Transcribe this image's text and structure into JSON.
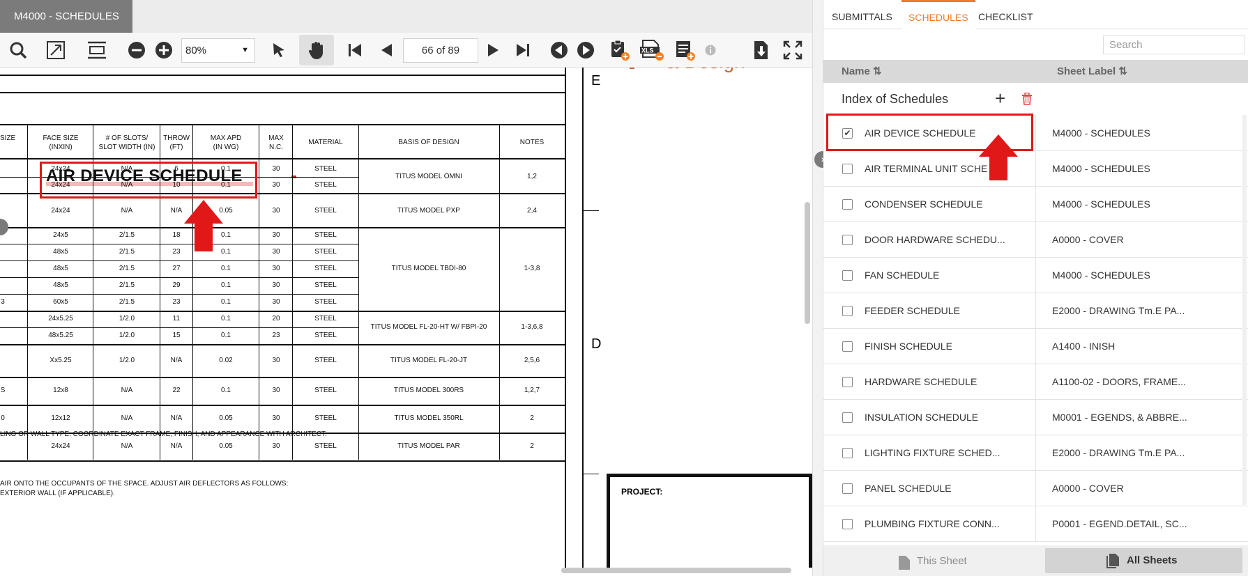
{
  "viewer": {
    "sheet_tab": "M4000 - SCHEDULES",
    "zoom": "80%",
    "page_indicator": "66 of 89"
  },
  "drawing": {
    "title": "AIR DEVICE SCHEDULE",
    "headers": [
      "SIZE",
      "FACE SIZE\n(INXIN)",
      "# OF SLOTS/\nSLOT WIDTH (IN)",
      "THROW\n(FT)",
      "MAX APD\n(IN WG)",
      "MAX\nN.C.",
      "MATERIAL",
      "BASIS OF DESIGN",
      "NOTES"
    ],
    "rows": [
      {
        "face": "24x24",
        "slots": "N/A",
        "throw": "6",
        "apd": "0.1",
        "nc": "30",
        "mat": "STEEL"
      },
      {
        "face": "24x24",
        "slots": "N/A",
        "throw": "10",
        "apd": "0.1",
        "nc": "30",
        "mat": "STEEL"
      },
      {
        "face": "24x24",
        "slots": "N/A",
        "throw": "N/A",
        "apd": "0.05",
        "nc": "30",
        "mat": "STEEL"
      },
      {
        "face": "24x5",
        "slots": "2/1.5",
        "throw": "18",
        "apd": "0.1",
        "nc": "30",
        "mat": "STEEL"
      },
      {
        "face": "48x5",
        "slots": "2/1.5",
        "throw": "23",
        "apd": "0.1",
        "nc": "30",
        "mat": "STEEL"
      },
      {
        "face": "48x5",
        "slots": "2/1.5",
        "throw": "27",
        "apd": "0.1",
        "nc": "30",
        "mat": "STEEL"
      },
      {
        "face": "48x5",
        "slots": "2/1.5",
        "throw": "29",
        "apd": "0.1",
        "nc": "30",
        "mat": "STEEL"
      },
      {
        "face": "60x5",
        "slots": "2/1.5",
        "throw": "23",
        "apd": "0.1",
        "nc": "30",
        "mat": "STEEL"
      },
      {
        "face": "24x5.25",
        "slots": "1/2.0",
        "throw": "11",
        "apd": "0.1",
        "nc": "20",
        "mat": "STEEL"
      },
      {
        "face": "48x5.25",
        "slots": "1/2.0",
        "throw": "15",
        "apd": "0.1",
        "nc": "23",
        "mat": "STEEL"
      },
      {
        "face": "Xx5.25",
        "slots": "1/2.0",
        "throw": "N/A",
        "apd": "0.02",
        "nc": "30",
        "mat": "STEEL"
      },
      {
        "face": "12x8",
        "slots": "N/A",
        "throw": "22",
        "apd": "0.1",
        "nc": "30",
        "mat": "STEEL"
      },
      {
        "face": "12x12",
        "slots": "N/A",
        "throw": "N/A",
        "apd": "0.05",
        "nc": "30",
        "mat": "STEEL"
      },
      {
        "face": "24x24",
        "slots": "N/A",
        "throw": "N/A",
        "apd": "0.05",
        "nc": "30",
        "mat": "STEEL"
      }
    ],
    "basis": [
      {
        "text": "TITUS MODEL OMNI",
        "notes": "1,2"
      },
      {
        "text": "TITUS MODEL PXP",
        "notes": "2,4"
      },
      {
        "text": "TITUS MODEL TBDI-80",
        "notes": "1-3,8"
      },
      {
        "text": "TITUS MODEL FL-20-HT W/ FBPI-20",
        "notes": "1-3,6,8"
      },
      {
        "text": "TITUS MODEL FL-20-JT",
        "notes": "2,5,6"
      },
      {
        "text": "TITUS MODEL 300RS",
        "notes": "1,2,7"
      },
      {
        "text": "TITUS MODEL 350RL",
        "notes": "2"
      },
      {
        "text": "TITUS MODEL PAR",
        "notes": "2"
      }
    ],
    "left_edge_marks": [
      "3",
      "S",
      "0"
    ],
    "note1": "LING OR WALL TYPE. COORDINATE EXACT FRAME, FINISH, AND APPEARANCE WITH ARCHITECT.",
    "note2": "AIR ONTO THE OCCUPANTS OF THE SPACE. ADJUST AIR DEFLECTORS AS FOLLOWS:",
    "note3": "EXTERIOR WALL (IF APPLICABLE).",
    "grid_e": "E",
    "grid_d": "D",
    "brand_partial": "& Design",
    "project_label": "PROJECT:"
  },
  "panel": {
    "tabs": [
      "SUBMITTALS",
      "SCHEDULES",
      "CHECKLIST"
    ],
    "search_placeholder": "Search",
    "col_name": "Name ⇅",
    "col_sheet": "Sheet Label ⇅",
    "group_title": "Index of Schedules",
    "items": [
      {
        "name": "AIR DEVICE SCHEDULE",
        "sheet": "M4000 - SCHEDULES",
        "checked": true
      },
      {
        "name": "AIR TERMINAL UNIT SCHE",
        "sheet": "M4000 - SCHEDULES",
        "checked": false
      },
      {
        "name": "CONDENSER SCHEDULE",
        "sheet": "M4000 - SCHEDULES",
        "checked": false
      },
      {
        "name": "DOOR HARDWARE SCHEDU...",
        "sheet": "A0000 - COVER",
        "checked": false
      },
      {
        "name": "FAN SCHEDULE",
        "sheet": "M4000 - SCHEDULES",
        "checked": false
      },
      {
        "name": "FEEDER SCHEDULE",
        "sheet": "E2000 - DRAWING Tm.E PA...",
        "checked": false
      },
      {
        "name": "FINISH SCHEDULE",
        "sheet": "A1400 - INISH",
        "checked": false
      },
      {
        "name": "HARDWARE SCHEDULE",
        "sheet": "A1100-02 - DOORS, FRAME...",
        "checked": false
      },
      {
        "name": "INSULATION SCHEDULE",
        "sheet": "M0001 - EGENDS, & ABBRE...",
        "checked": false
      },
      {
        "name": "LIGHTING FIXTURE SCHED...",
        "sheet": "E2000 - DRAWING Tm.E PA...",
        "checked": false
      },
      {
        "name": "PANEL SCHEDULE",
        "sheet": "A0000 - COVER",
        "checked": false
      },
      {
        "name": "PLUMBING FIXTURE CONN...",
        "sheet": "P0001 - EGEND.DETAIL, SC...",
        "checked": false
      }
    ],
    "btn_this_sheet": "This Sheet",
    "btn_all_sheets": "All Sheets"
  },
  "colors": {
    "accent": "#f07b2a",
    "highlight": "#e01818",
    "toolbar_orange": "#f58220"
  }
}
